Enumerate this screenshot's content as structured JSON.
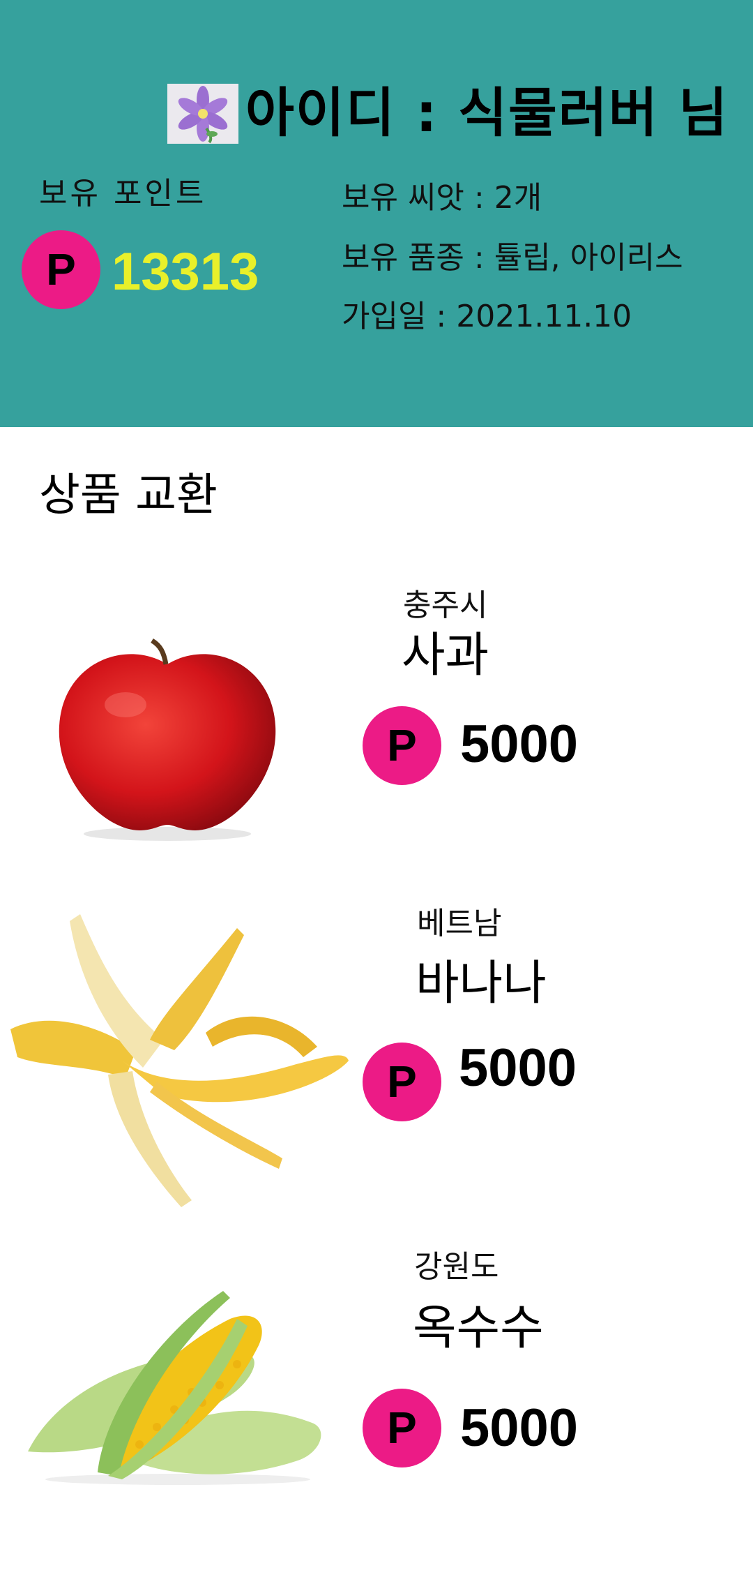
{
  "profile": {
    "avatar_icon": "flower-icon",
    "id_text": "아이디 : 식물러버 님",
    "points_label": "보유 포인트",
    "points_symbol": "P",
    "points_value": "13313",
    "seeds": "보유 씨앗 : 2개",
    "varieties": "보유 품종 : 튤립, 아이리스",
    "join_date": "가입일 : 2021.11.10"
  },
  "exchange": {
    "title": "상품 교환",
    "products": [
      {
        "origin": "충주시",
        "name": "사과",
        "symbol": "P",
        "price": "5000",
        "image_icon": "apple-image"
      },
      {
        "origin": "베트남",
        "name": "바나나",
        "symbol": "P",
        "price": "5000",
        "image_icon": "banana-image"
      },
      {
        "origin": "강원도",
        "name": "옥수수",
        "symbol": "P",
        "price": "5000",
        "image_icon": "corn-image"
      }
    ]
  },
  "colors": {
    "header_bg": "#36A19D",
    "point_badge": "#EC1B86",
    "point_value": "#E9F02A"
  }
}
